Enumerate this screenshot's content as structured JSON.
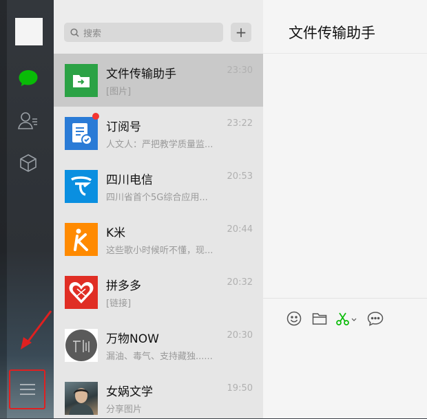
{
  "search": {
    "placeholder": "搜索",
    "icon": "search-icon"
  },
  "add_button": {
    "label": "+"
  },
  "nav": {
    "icons": [
      "chat-icon",
      "contacts-icon",
      "box-icon",
      "menu-icon"
    ],
    "accent": "#09bb07"
  },
  "conversations": [
    {
      "name": "文件传输助手",
      "time": "23:30",
      "preview": "[图片]",
      "active": true
    },
    {
      "name": "订阅号",
      "time": "23:22",
      "preview": "人文人：严把教学质量监...",
      "unread": true
    },
    {
      "name": "四川电信",
      "time": "20:53",
      "preview": "四川省首个5G综合应用..."
    },
    {
      "name": "K米",
      "time": "20:44",
      "preview": "这些歌小时候听不懂，现..."
    },
    {
      "name": "拼多多",
      "time": "20:32",
      "preview": "[链接]"
    },
    {
      "name": "万物NOW",
      "time": "20:30",
      "preview": "漏油、毒气、支持藏独......"
    },
    {
      "name": "女娲文学",
      "time": "19:50",
      "preview": "分享图片"
    }
  ],
  "chat": {
    "title": "文件传输助手"
  },
  "toolbar": {
    "icons": [
      "emoji-icon",
      "folder-icon",
      "scissors-icon",
      "chat-bubble-icon"
    ]
  },
  "annotation": {
    "highlight_color": "#e02020"
  }
}
